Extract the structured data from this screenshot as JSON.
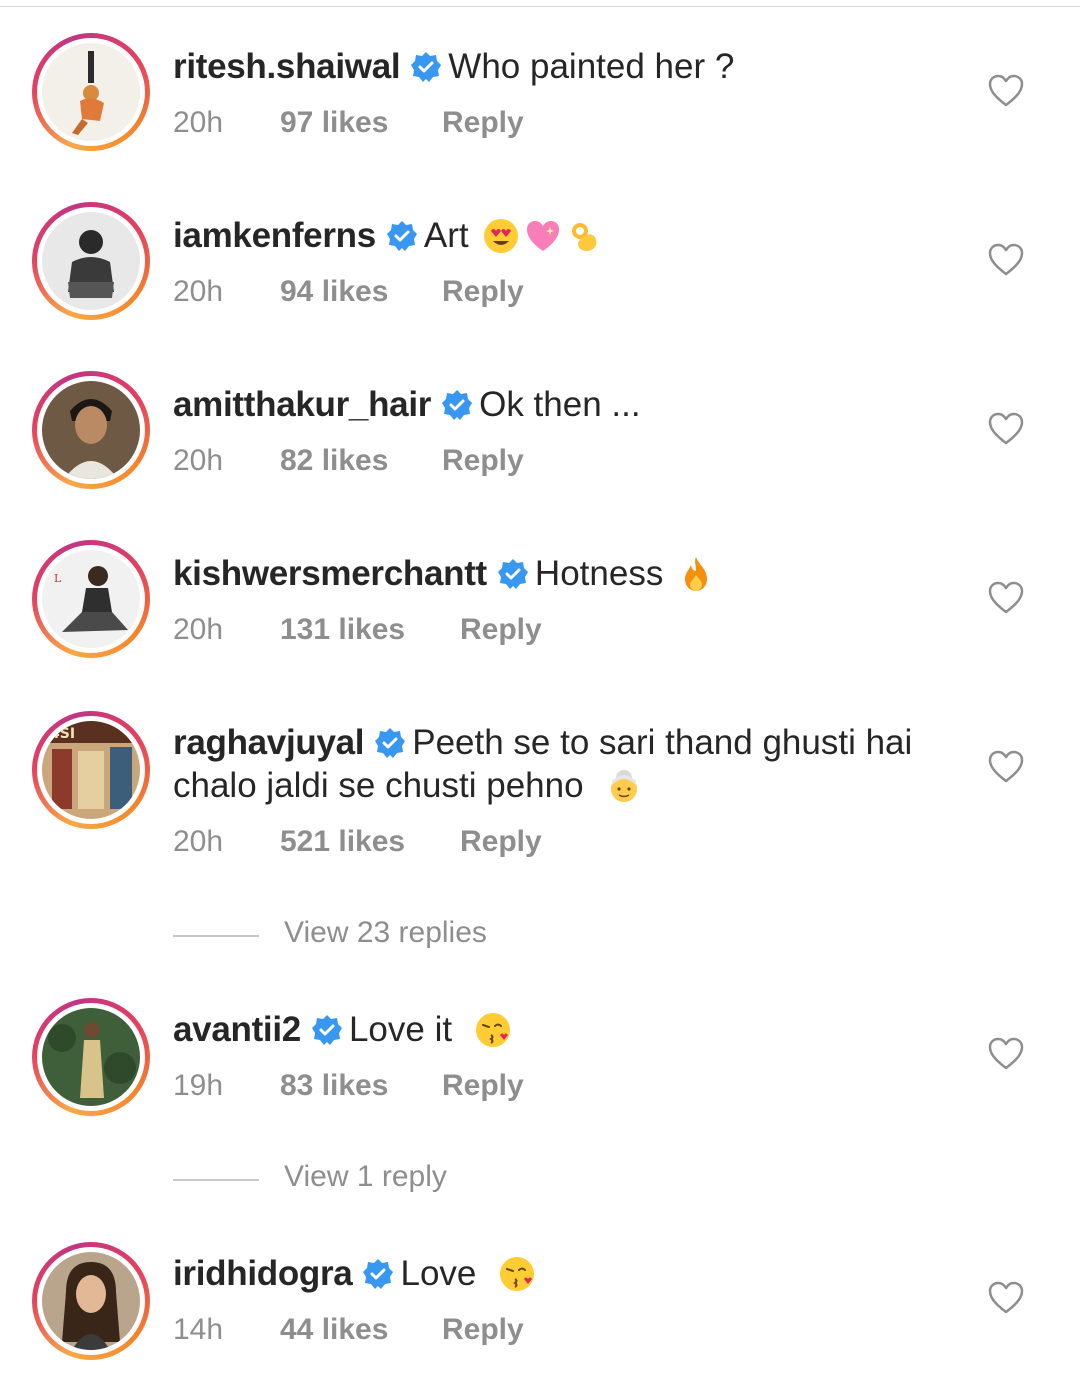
{
  "comments": [
    {
      "username": "ritesh.shaiwal",
      "text": "Who painted her ?",
      "emojis": [],
      "time": "20h",
      "likes": "97 likes",
      "reply": "Reply",
      "avatar_icon": "person-handstand-avatar"
    },
    {
      "username": "iamkenferns",
      "text": "Art",
      "emojis": [
        "heart-eyes-emoji",
        "sparkling-heart-emoji",
        "ok-hand-emoji"
      ],
      "time": "20h",
      "likes": "94 likes",
      "reply": "Reply",
      "avatar_icon": "person-sitting-avatar"
    },
    {
      "username": "amitthakur_hair",
      "text": "Ok then ...",
      "emojis": [],
      "time": "20h",
      "likes": "82 likes",
      "reply": "Reply",
      "avatar_icon": "man-selfie-avatar"
    },
    {
      "username": "kishwersmerchantt",
      "text": "Hotness",
      "emojis": [
        "fire-emoji"
      ],
      "time": "20h",
      "likes": "131 likes",
      "reply": "Reply",
      "avatar_icon": "woman-sitting-avatar"
    },
    {
      "username": "raghavjuyal",
      "text": "Peeth se to sari thand ghusti hai",
      "text2": "chalo jaldi se chusti pehno",
      "emojis": [
        "older-woman-emoji"
      ],
      "time": "20h",
      "likes": "521 likes",
      "reply": "Reply",
      "avatar_icon": "movie-poster-avatar",
      "view_replies": "View 23 replies"
    },
    {
      "username": "avantii2",
      "text": "Love it",
      "emojis": [
        "kissing-face-emoji"
      ],
      "time": "19h",
      "likes": "83 likes",
      "reply": "Reply",
      "avatar_icon": "woman-gold-dress-avatar",
      "view_replies": "View 1 reply"
    },
    {
      "username": "iridhidogra",
      "text": "Love",
      "emojis": [
        "kissing-face-emoji"
      ],
      "time": "14h",
      "likes": "44 likes",
      "reply": "Reply",
      "avatar_icon": "woman-portrait-avatar"
    }
  ],
  "colors": {
    "text": "#262626",
    "secondary": "#8e8e8e",
    "verified": "#3897f0",
    "ring_start": "#f9a847",
    "ring_end": "#c13584"
  }
}
